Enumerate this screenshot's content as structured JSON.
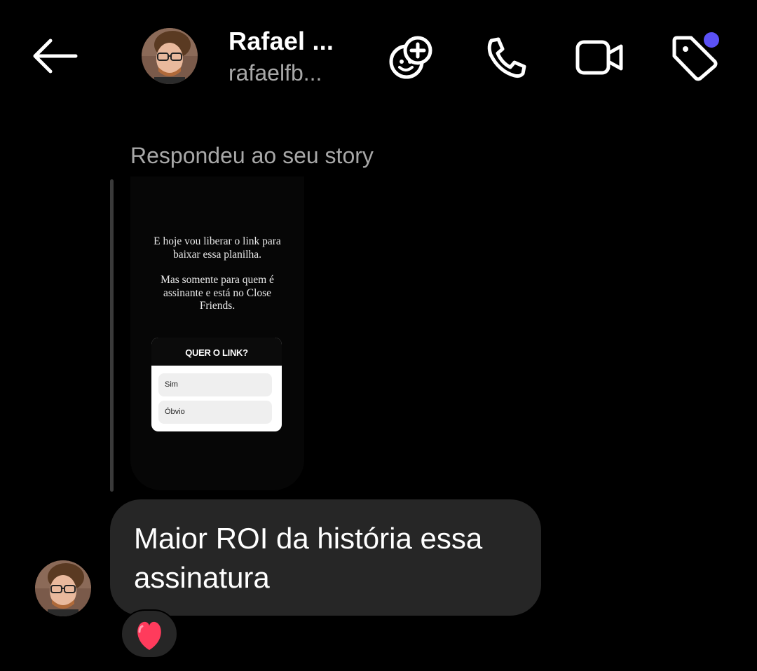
{
  "header": {
    "contact_name": "Rafael ...",
    "contact_username": "rafaelfb...",
    "icons": {
      "back": "arrow-left-icon",
      "effects": "sticker-plus-icon",
      "call": "phone-icon",
      "video": "video-camera-icon",
      "tag": "tag-icon"
    },
    "notification_dot_color": "#5b51f6"
  },
  "story_reply": {
    "label": "Respondeu ao seu story",
    "story": {
      "line1": "E hoje vou liberar o link para\nbaixar essa planilha.",
      "line2": "Mas somente para quem é\nassinante e está no Close\nFriends.",
      "poll": {
        "question": "QUER O LINK?",
        "options": [
          "Sim",
          "Óbvio"
        ]
      }
    }
  },
  "message": {
    "text": "Maior ROI da história essa assinatura",
    "reaction": "heart-emoji"
  },
  "colors": {
    "background": "#000000",
    "bubble": "#262626",
    "secondary_text": "#a8a8a8"
  }
}
